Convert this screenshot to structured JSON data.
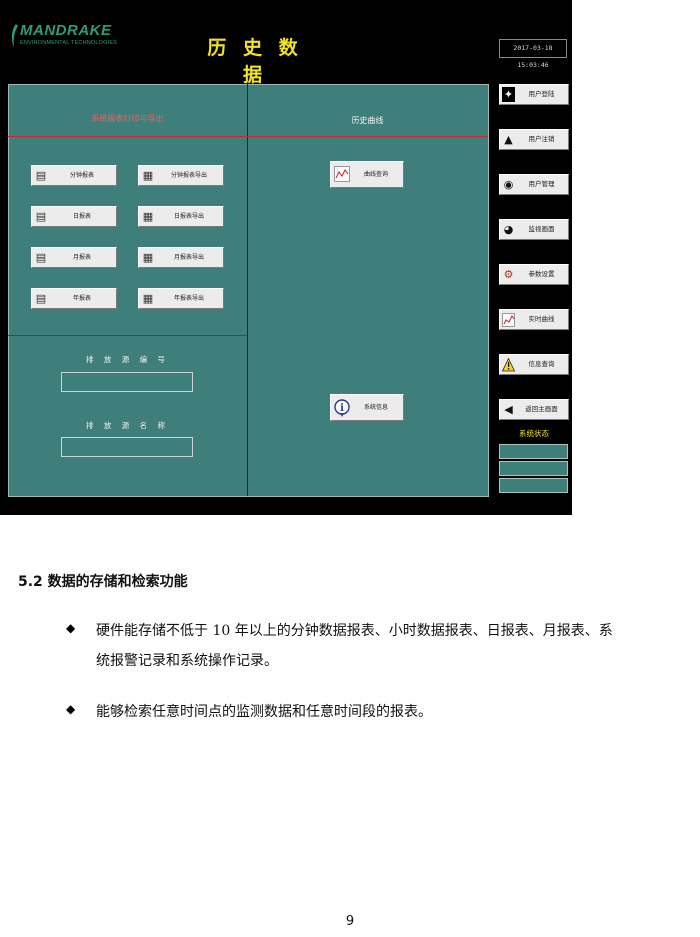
{
  "screenshot": {
    "logo": {
      "name": "MANDRAKE",
      "tagline": "ENVIRONMENTAL TECHNOLOGIES"
    },
    "title": "历 史 数 据",
    "datetime": "2017-03-18 15:03:46",
    "report_section": {
      "title": "系统报表打印与导出",
      "buttons": [
        {
          "label": "分钟报表",
          "icon": "report-icon"
        },
        {
          "label": "分钟报表导出",
          "icon": "export-icon"
        },
        {
          "label": "日报表",
          "icon": "report-icon"
        },
        {
          "label": "日报表导出",
          "icon": "export-icon"
        },
        {
          "label": "月报表",
          "icon": "report-icon"
        },
        {
          "label": "月报表导出",
          "icon": "export-icon"
        },
        {
          "label": "年报表",
          "icon": "report-icon"
        },
        {
          "label": "年报表导出",
          "icon": "export-icon"
        }
      ]
    },
    "source_number": {
      "label": "排 放 源 编 号",
      "value": ""
    },
    "source_name": {
      "label": "排 放 源 名 称",
      "value": ""
    },
    "curve_section": {
      "title": "历史曲线",
      "query_button": "曲线查询",
      "sysinfo_button": "系统信息"
    },
    "sidebar": [
      {
        "label": "用户登陆",
        "icon": "walking-person-icon"
      },
      {
        "label": "用户注销",
        "icon": "exit-person-icon"
      },
      {
        "label": "用户管理",
        "icon": "user-manage-icon"
      },
      {
        "label": "监视画面",
        "icon": "binoculars-icon"
      },
      {
        "label": "参数设置",
        "icon": "settings-icon"
      },
      {
        "label": "实时曲线",
        "icon": "chart-icon"
      },
      {
        "label": "信息查询",
        "icon": "warning-icon"
      },
      {
        "label": "返回主画面",
        "icon": "back-arrow-icon"
      }
    ],
    "system_status_label": "系统状态",
    "colors": {
      "panel": "#3e7f7b",
      "title": "#f2e322",
      "accent_red": "#d0262e",
      "accent_blue": "#2040d8"
    }
  },
  "document": {
    "section_heading": "5.2 数据的存储和检索功能",
    "bullets": [
      {
        "line1": "硬件能存储不低于 10 年以上的分钟数据报表、小时数据报表、日报表、月报表、系",
        "line2": "统报警记录和系统操作记录。"
      },
      {
        "line1": "能够检索任意时间点的监测数据和任意时间段的报表。",
        "line2": ""
      }
    ],
    "page_number": "9"
  }
}
